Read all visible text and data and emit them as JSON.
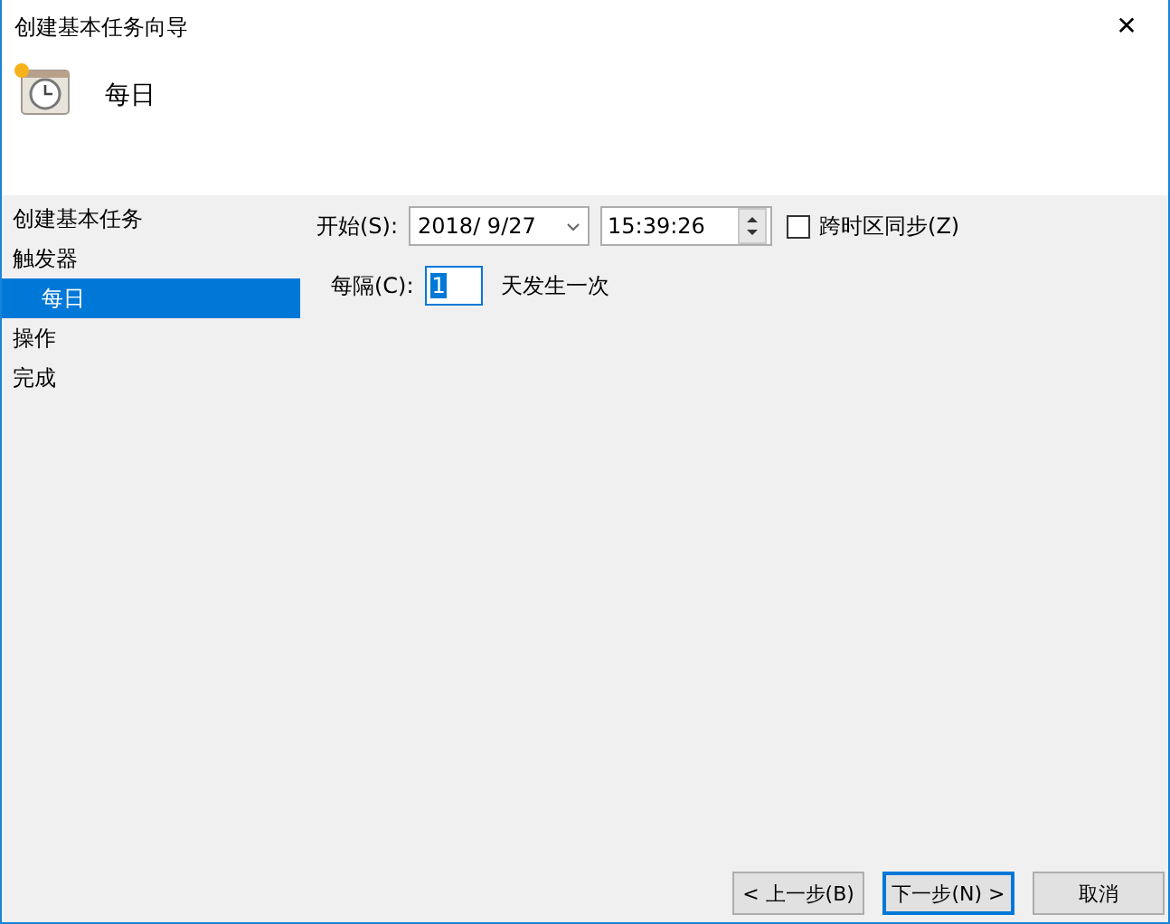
{
  "window": {
    "title": "创建基本任务向导",
    "close": "✕"
  },
  "header": {
    "title": "每日"
  },
  "sidebar": {
    "items": [
      {
        "label": "创建基本任务",
        "selected": false
      },
      {
        "label": "触发器",
        "selected": false,
        "children": [
          {
            "label": "每日",
            "selected": true
          }
        ]
      },
      {
        "label": "操作",
        "selected": false
      },
      {
        "label": "完成",
        "selected": false
      }
    ]
  },
  "start": {
    "label": "开始(S):",
    "date": "2018/  9/27",
    "time": "15:39:26"
  },
  "sync": {
    "label": "跨时区同步(Z)",
    "checked": false
  },
  "recur": {
    "label": "每隔(C):",
    "value": "1",
    "unit": "天发生一次"
  },
  "buttons": [
    {
      "label": "< 上一步(B)",
      "focused": false
    },
    {
      "label": "下一步(N) >",
      "focused": true
    },
    {
      "label": "取消",
      "focused": false
    }
  ]
}
